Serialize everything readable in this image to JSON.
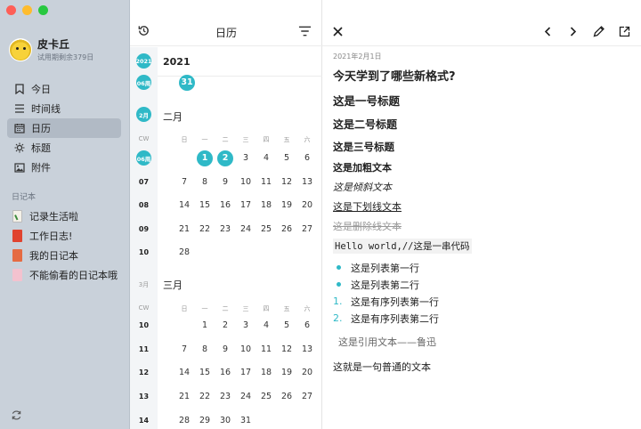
{
  "profile": {
    "name": "皮卡丘",
    "subtitle": "试用期剩余379日"
  },
  "nav": [
    {
      "icon": "bookmark-icon",
      "label": "今日"
    },
    {
      "icon": "timeline-icon",
      "label": "时间线"
    },
    {
      "icon": "calendar-icon",
      "label": "日历"
    },
    {
      "icon": "tag-icon",
      "label": "标题"
    },
    {
      "icon": "image-icon",
      "label": "附件"
    }
  ],
  "journals_label": "日记本",
  "journals": [
    {
      "label": "记录生活啦"
    },
    {
      "label": "工作日志!"
    },
    {
      "label": "我的日记本"
    },
    {
      "label": "不能偷看的日记本哦"
    }
  ],
  "calendar": {
    "title": "日历",
    "year": "2021",
    "year_pill": "2021",
    "week_06_top": "06周",
    "jan_day": "31",
    "feb_pill": "2月",
    "feb_label": "二月",
    "cw": "CW",
    "dow": [
      "日",
      "一",
      "二",
      "三",
      "四",
      "五",
      "六"
    ],
    "feb_weeks": [
      {
        "wk": "06周",
        "days": [
          "",
          "1",
          "2",
          "3",
          "4",
          "5",
          "6"
        ]
      },
      {
        "wk": "07",
        "days": [
          "7",
          "8",
          "9",
          "10",
          "11",
          "12",
          "13"
        ]
      },
      {
        "wk": "08",
        "days": [
          "14",
          "15",
          "16",
          "17",
          "18",
          "19",
          "20"
        ]
      },
      {
        "wk": "09",
        "days": [
          "21",
          "22",
          "23",
          "24",
          "25",
          "26",
          "27"
        ]
      },
      {
        "wk": "10",
        "days": [
          "28",
          "",
          "",
          "",
          "",
          "",
          ""
        ]
      }
    ],
    "mar_small": "3月",
    "mar_label": "三月",
    "mar_weeks": [
      {
        "wk": "10",
        "days": [
          "",
          "1",
          "2",
          "3",
          "4",
          "5",
          "6"
        ]
      },
      {
        "wk": "11",
        "days": [
          "7",
          "8",
          "9",
          "10",
          "11",
          "12",
          "13"
        ]
      },
      {
        "wk": "12",
        "days": [
          "14",
          "15",
          "16",
          "17",
          "18",
          "19",
          "20"
        ]
      },
      {
        "wk": "13",
        "days": [
          "21",
          "22",
          "23",
          "24",
          "25",
          "26",
          "27"
        ]
      },
      {
        "wk": "14",
        "days": [
          "28",
          "29",
          "30",
          "31",
          "",
          "",
          ""
        ]
      }
    ]
  },
  "editor": {
    "date": "2021年2月1日",
    "question": "今天学到了哪些新格式?",
    "h1": "这是一号标题",
    "h2": "这是二号标题",
    "h3": "这是三号标题",
    "bold": "这是加粗文本",
    "italic": "这是倾斜文本",
    "underline": "这是下划线文本",
    "strike": "这是删除线文本",
    "code": "Hello world,//这是一串代码",
    "bullets": [
      "这是列表第一行",
      "这是列表第二行"
    ],
    "ordered": [
      {
        "n": "1.",
        "text": "这是有序列表第一行"
      },
      {
        "n": "2.",
        "text": "这是有序列表第二行"
      }
    ],
    "quote": "这是引用文本——鲁迅",
    "plain": "这就是一句普通的文本"
  },
  "colors": {
    "accent": "#2fb9c7",
    "sidebar": "#c9d1da"
  }
}
